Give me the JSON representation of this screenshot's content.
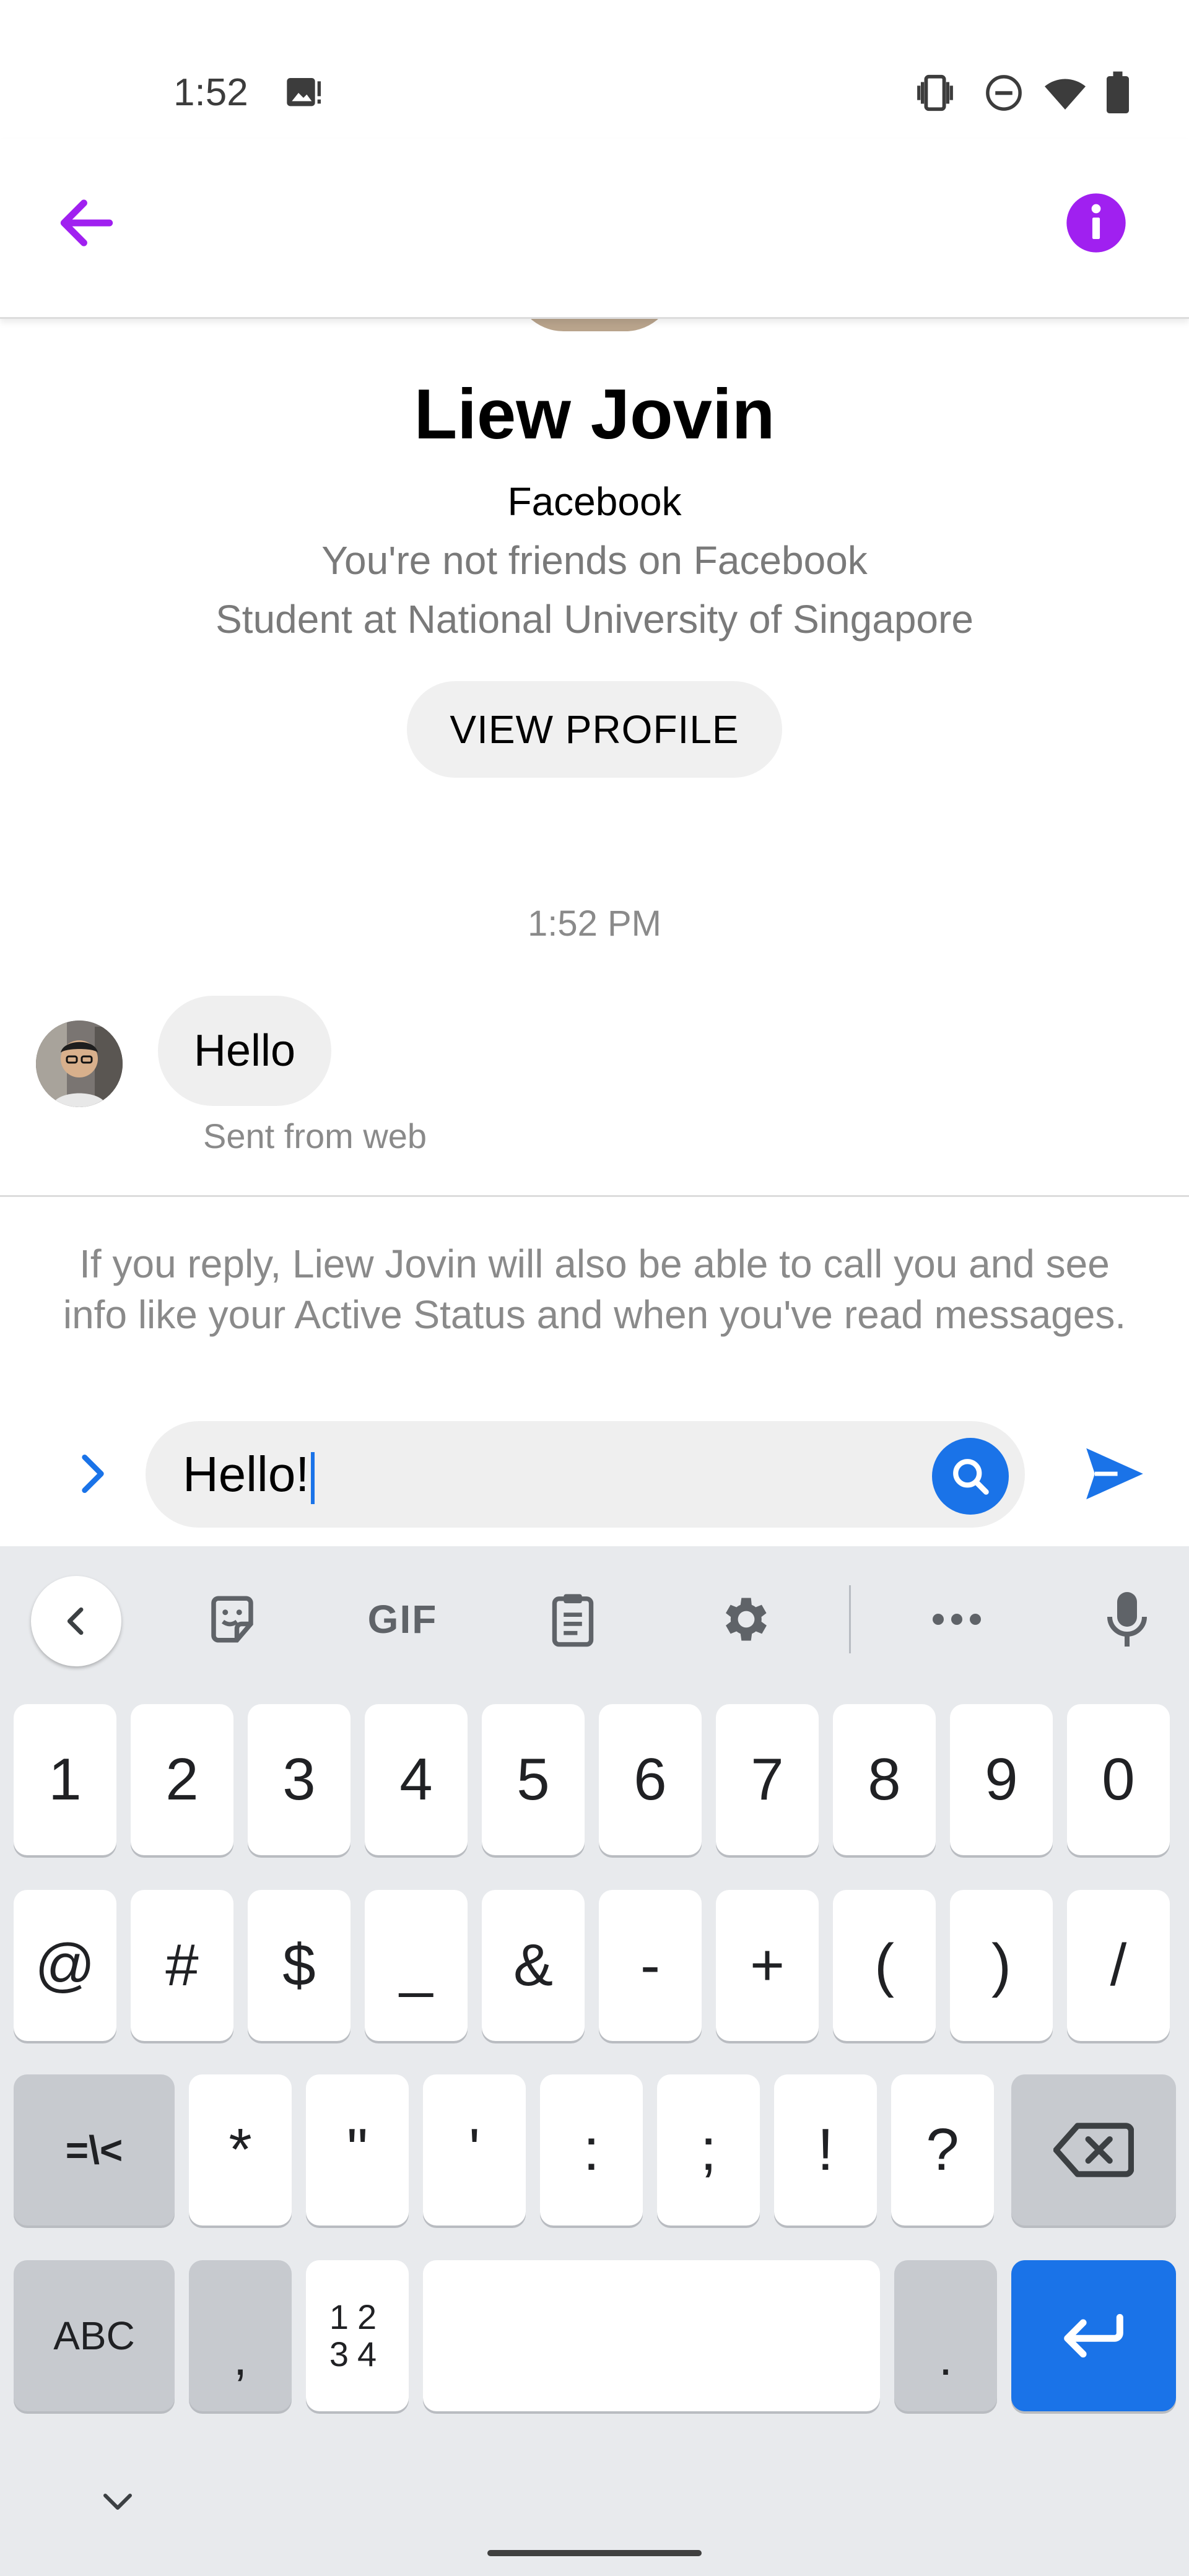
{
  "status_bar": {
    "time": "1:52",
    "icons": [
      "image-notification-icon",
      "vibrate-icon",
      "do-not-disturb-icon",
      "wifi-icon",
      "battery-icon"
    ]
  },
  "header": {
    "back_icon": "arrow-left-icon",
    "info_icon": "info-icon",
    "accent_color": "#a020f0"
  },
  "profile": {
    "name": "Liew Jovin",
    "platform": "Facebook",
    "friend_status": "You're not friends on Facebook",
    "bio": "Student at National University of Singapore",
    "view_profile_label": "VIEW PROFILE"
  },
  "conversation": {
    "timestamp": "1:52 PM",
    "messages": [
      {
        "text": "Hello",
        "meta": "Sent from web",
        "incoming": true
      }
    ]
  },
  "reply_notice": "If you reply, Liew Jovin will also be able to call you and see info like your Active Status and when you've read messages.",
  "composer": {
    "value": "Hello!",
    "expand_icon": "chevron-right-icon",
    "search_icon": "search-icon",
    "send_icon": "send-icon",
    "accent_color": "#1a73e8"
  },
  "keyboard": {
    "toolbar": {
      "back_icon": "chevron-left-icon",
      "sticker_icon": "sticker-icon",
      "gif_label": "GIF",
      "clipboard_icon": "clipboard-icon",
      "settings_icon": "gear-icon",
      "more_icon": "more-horizontal-icon",
      "mic_icon": "microphone-icon"
    },
    "row1": [
      "1",
      "2",
      "3",
      "4",
      "5",
      "6",
      "7",
      "8",
      "9",
      "0"
    ],
    "row2": [
      "@",
      "#",
      "$",
      "_",
      "&",
      "-",
      "+",
      "(",
      ")",
      "/"
    ],
    "row3": {
      "shift_label": "=\\<",
      "keys": [
        "*",
        "\"",
        "'",
        ":",
        ";",
        "!",
        "?"
      ],
      "backspace_icon": "backspace-icon"
    },
    "row4": {
      "abc_label": "ABC",
      "comma": ",",
      "numpad_top": "12",
      "numpad_bottom": "34",
      "period": ".",
      "enter_icon": "enter-icon"
    },
    "hide_icon": "chevron-down-icon"
  }
}
